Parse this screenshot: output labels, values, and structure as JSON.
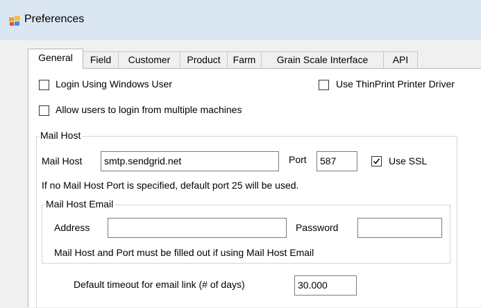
{
  "window": {
    "title": "Preferences",
    "icon": "app-window-icon"
  },
  "tabs": [
    {
      "label": "General",
      "active": true
    },
    {
      "label": "Field"
    },
    {
      "label": "Customer"
    },
    {
      "label": "Product"
    },
    {
      "label": "Farm"
    },
    {
      "label": "Grain Scale Interface"
    },
    {
      "label": "API"
    }
  ],
  "options": {
    "login_windows_user": {
      "label": "Login Using Windows User",
      "checked": false
    },
    "use_thinprint": {
      "label": "Use ThinPrint Printer Driver",
      "checked": false
    },
    "allow_multiple_machines": {
      "label": "Allow users to login from multiple machines",
      "checked": false
    }
  },
  "mail_host": {
    "group_title": "Mail Host",
    "host_label": "Mail Host",
    "host_value": "smtp.sendgrid.net",
    "port_label": "Port",
    "port_value": "587",
    "ssl_label": "Use SSL",
    "ssl_checked": true,
    "port_note": "If no Mail Host Port is specified, default port 25 will be used.",
    "email_group": {
      "title": "Mail Host Email",
      "address_label": "Address",
      "address_value": "",
      "password_label": "Password",
      "password_value": "",
      "note": "Mail Host and Port must be filled out if using Mail Host Email"
    },
    "timeout_label": "Default timeout for email link (# of days)",
    "timeout_value": "30.000"
  }
}
